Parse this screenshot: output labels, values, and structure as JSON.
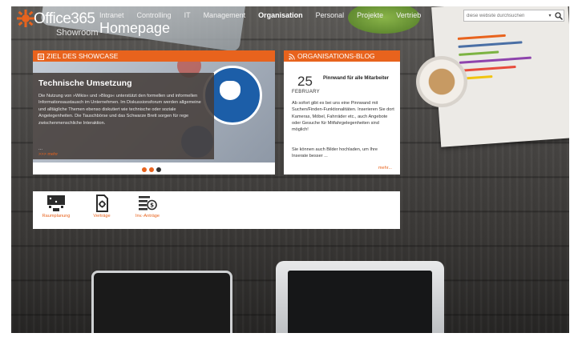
{
  "brand": {
    "name": "Office365",
    "subtitle": "Showroom",
    "page_title": "Homepage"
  },
  "nav": {
    "items": [
      "Intranet",
      "Controlling",
      "IT",
      "Management",
      "Organisation",
      "Personal",
      "Projekte",
      "Vertrieb"
    ],
    "active": "Organisation"
  },
  "search": {
    "placeholder": "diese website durchsuchen"
  },
  "showcase": {
    "header": "ZIEL DES SHOWCASE",
    "slide_title": "Technische Umsetzung",
    "slide_text": "Die Nutzung von »Wikis« und »Blogs« unterstützt den formellen und informellen Informationsaustausch im Unternehmen. Im Diskussionsforum werden allgemeine und alltägliche Themen ebenso diskutiert wie technische oder soziale Angelegenheiten. Die Tauschbörse und das Schwarze Brett sorgen für rege zwischenmenschliche Interaktion.",
    "ellipsis": "...",
    "more_link": ">>> mehr"
  },
  "blog": {
    "header": "ORGANISATIONS-BLOG",
    "day": "25",
    "month": "FEBRUARY",
    "post_title": "Pinnwand für alle Mitarbeiter",
    "text_1": "Ab sofort gibt es bei uns eine Pinnwand mit Suchen/Finden-Funktionalitäten. Inserieren Sie dort Kameras, Möbel, Fahrräder etc., auch Angebote oder Gesuche für Mitfahrgelegenheiten sind möglich!",
    "text_2": "Sie können auch Bilder hochladen, um Ihre Inserate besser ...",
    "more_link": "mehr..."
  },
  "tiles": [
    {
      "label": "Raumplanung",
      "icon": "room-planning-icon"
    },
    {
      "label": "Verträge",
      "icon": "contract-icon"
    },
    {
      "label": "Inv.-Anträge",
      "icon": "investment-request-icon"
    }
  ],
  "colors": {
    "accent": "#e8631d",
    "overlay": "#463e3a"
  }
}
